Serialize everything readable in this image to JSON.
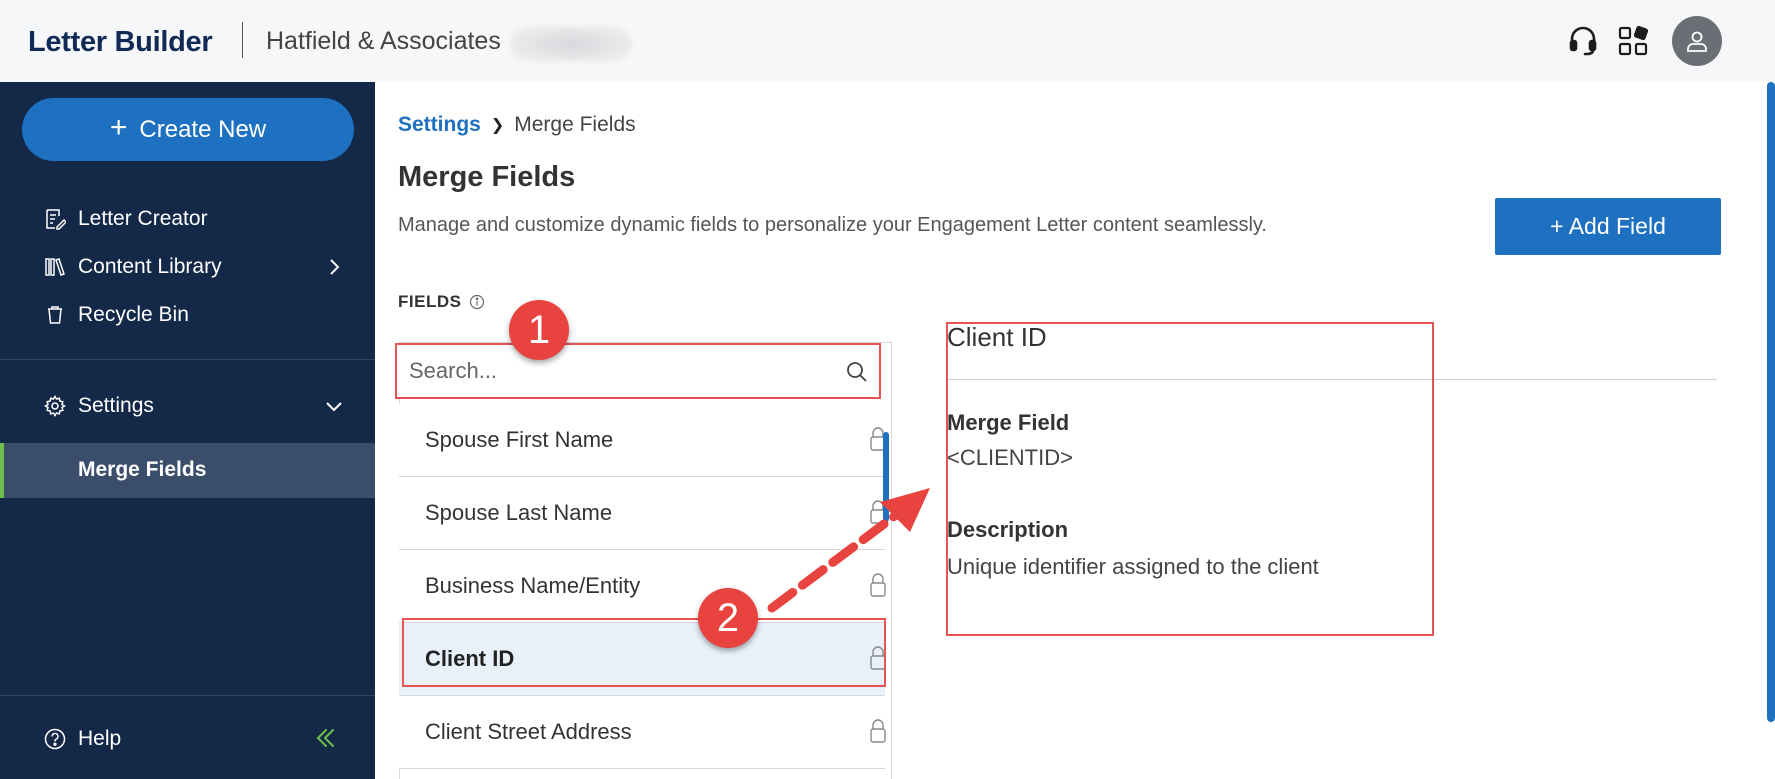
{
  "header": {
    "brand": "Letter Builder",
    "org_name": "Hatfield & Associates",
    "icons": [
      "headset-icon",
      "apps-grid-icon",
      "user-avatar-icon"
    ]
  },
  "sidebar": {
    "create_label": "Create New",
    "items": [
      {
        "label": "Letter Creator",
        "icon": "letter-creator-icon"
      },
      {
        "label": "Content Library",
        "icon": "library-books-icon"
      },
      {
        "label": "Recycle Bin",
        "icon": "trash-icon"
      },
      {
        "label": "Settings",
        "icon": "gear-icon"
      },
      {
        "label": "Merge Fields"
      }
    ],
    "help_label": "Help"
  },
  "main": {
    "breadcrumb": {
      "parent": "Settings",
      "current": "Merge Fields"
    },
    "title": "Merge Fields",
    "description": "Manage and customize dynamic fields to personalize your Engagement Letter content seamlessly.",
    "add_button_label": "+ Add Field",
    "fields_label": "FIELDS",
    "search_placeholder": "Search...",
    "fields": [
      "Spouse First Name",
      "Spouse Last Name",
      "Business Name/Entity",
      "Client ID",
      "Client Street Address"
    ],
    "selected_index": 3,
    "detail": {
      "title": "Client ID",
      "merge_field_label": "Merge Field",
      "merge_field_value": "<CLIENTID>",
      "description_label": "Description",
      "description_value": "Unique identifier assigned to the client"
    }
  },
  "annotations": {
    "step1": "1",
    "step2": "2"
  },
  "colors": {
    "sidebar_bg": "#142848",
    "accent_blue": "#1e70c0",
    "active_green": "#6cc04a",
    "annotation_red": "#e55353"
  }
}
